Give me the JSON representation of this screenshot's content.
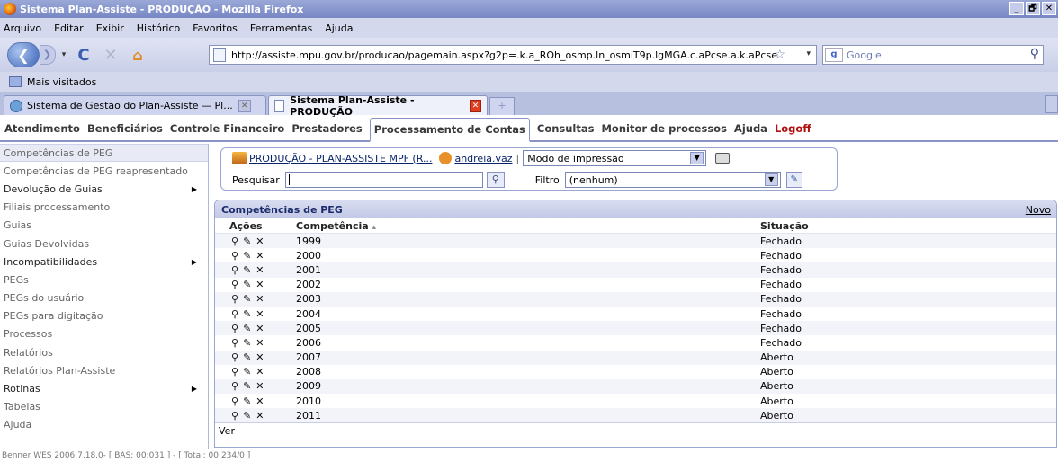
{
  "window": {
    "title": "Sistema Plan-Assiste - PRODUÇÃO - Mozilla Firefox",
    "min": "_",
    "max": "🗗",
    "close": "✕"
  },
  "menubar": [
    "Arquivo",
    "Editar",
    "Exibir",
    "Histórico",
    "Favoritos",
    "Ferramentas",
    "Ajuda"
  ],
  "navbar": {
    "url": "http://assiste.mpu.gov.br/producao/pagemain.aspx?g2p=.k.a_ROh_osmp.ln_osmiT9p.lgMGA.c.aPcse.a.k.aPcse",
    "search_placeholder": "Google",
    "google_icon": "g"
  },
  "bookmarks": {
    "label": "Mais visitados"
  },
  "tabs": [
    {
      "label": "Sistema de Gestão do Plan-Assiste — Pl...",
      "active": false
    },
    {
      "label": "Sistema Plan-Assiste - PRODUÇÃO",
      "active": true
    }
  ],
  "appnav": [
    "Atendimento",
    "Beneficiários",
    "Controle Financeiro",
    "Prestadores",
    "Processamento de Contas",
    "Consultas",
    "Monitor de processos",
    "Ajuda",
    "Logoff"
  ],
  "sidebar": [
    {
      "label": "Competências de PEG",
      "arrow": false
    },
    {
      "label": "Competências de PEG reapresentado",
      "arrow": false
    },
    {
      "label": "Devolução de Guias",
      "arrow": true
    },
    {
      "label": "Filiais processamento",
      "arrow": false
    },
    {
      "label": "Guias",
      "arrow": false
    },
    {
      "label": "Guias Devolvidas",
      "arrow": false
    },
    {
      "label": "Incompatibilidades",
      "arrow": true
    },
    {
      "label": "PEGs",
      "arrow": false
    },
    {
      "label": "PEGs do usuário",
      "arrow": false
    },
    {
      "label": "PEGs para digitação",
      "arrow": false
    },
    {
      "label": "Processos",
      "arrow": false
    },
    {
      "label": "Relatórios",
      "arrow": false
    },
    {
      "label": "Relatórios Plan-Assiste",
      "arrow": false
    },
    {
      "label": "Rotinas",
      "arrow": true
    },
    {
      "label": "Tabelas",
      "arrow": false
    },
    {
      "label": "Ajuda",
      "arrow": false
    }
  ],
  "filter": {
    "context_link": "PRODUÇÃO - PLAN-ASSISTE MPF (R...",
    "user_link": "andreia.vaz",
    "separator": "|",
    "mode_value": "Modo de impressão",
    "search_label": "Pesquisar",
    "search_value": "",
    "filter_label": "Filtro",
    "filter_value": "(nenhum)"
  },
  "grid": {
    "title": "Competências de PEG",
    "new_label": "Novo",
    "columns": [
      "Ações",
      "Competência",
      "Situação"
    ],
    "sort_indicator": "▴",
    "action_icons": [
      "magnify-icon",
      "pencil-icon",
      "delete-icon"
    ],
    "rows": [
      {
        "competencia": "1999",
        "situacao": "Fechado"
      },
      {
        "competencia": "2000",
        "situacao": "Fechado"
      },
      {
        "competencia": "2001",
        "situacao": "Fechado"
      },
      {
        "competencia": "2002",
        "situacao": "Fechado"
      },
      {
        "competencia": "2003",
        "situacao": "Fechado"
      },
      {
        "competencia": "2004",
        "situacao": "Fechado"
      },
      {
        "competencia": "2005",
        "situacao": "Fechado"
      },
      {
        "competencia": "2006",
        "situacao": "Fechado"
      },
      {
        "competencia": "2007",
        "situacao": "Aberto"
      },
      {
        "competencia": "2008",
        "situacao": "Aberto"
      },
      {
        "competencia": "2009",
        "situacao": "Aberto"
      },
      {
        "competencia": "2010",
        "situacao": "Aberto"
      },
      {
        "competencia": "2011",
        "situacao": "Aberto"
      }
    ],
    "footer_label": "Ver"
  },
  "footer": "Benner WES 2006.7.18.0- [ BAS: 00:031 ] - [ Total: 00:234/0 ]"
}
